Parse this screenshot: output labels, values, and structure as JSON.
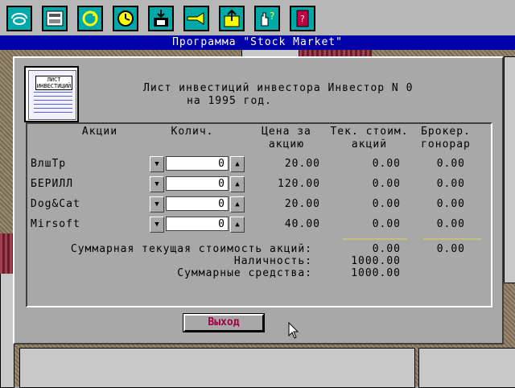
{
  "window": {
    "title": "Программа \"Stock Market\""
  },
  "toolbar": {
    "icons": [
      "phone-icon",
      "calculator-icon",
      "refresh-icon",
      "clock-icon",
      "save-icon",
      "horn-icon",
      "export-icon",
      "help-icon",
      "book-icon"
    ]
  },
  "dialog": {
    "icon_caption": "ЛИСТ",
    "icon_subcaption": "ИНВЕСТИЦИЙ",
    "heading_line1": "Лист инвестиций инвестора Инвестор N 0",
    "heading_line2": "на 1995 год.",
    "columns": {
      "stock": "Акции",
      "qty": "Колич.",
      "price1": "Цена за",
      "price2": "акцию",
      "value1": "Тек. стоим.",
      "value2": "акций",
      "fee1": "Брокер.",
      "fee2": "гонорар"
    },
    "rows": [
      {
        "name": "ВлшТр",
        "qty": "0",
        "price": "20.00",
        "value": "0.00",
        "fee": "0.00"
      },
      {
        "name": "БЕРИЛЛ",
        "qty": "0",
        "price": "120.00",
        "value": "0.00",
        "fee": "0.00"
      },
      {
        "name": "Dog&Cat",
        "qty": "0",
        "price": "20.00",
        "value": "0.00",
        "fee": "0.00"
      },
      {
        "name": "Mirsoft",
        "qty": "0",
        "price": "40.00",
        "value": "0.00",
        "fee": "0.00"
      }
    ],
    "summary": {
      "total_value_label": "Суммарная текущая стоимость акций:",
      "total_value": "0.00",
      "total_fee": "0.00",
      "cash_label": "Наличность:",
      "cash": "1000.00",
      "total_funds_label": "Суммарные средства:",
      "total_funds": "1000.00"
    },
    "exit_label": "Выход"
  },
  "colors": {
    "titlebar": "#0000a8",
    "toolbar_button": "#00a8a8",
    "exit_text": "#a00040"
  }
}
